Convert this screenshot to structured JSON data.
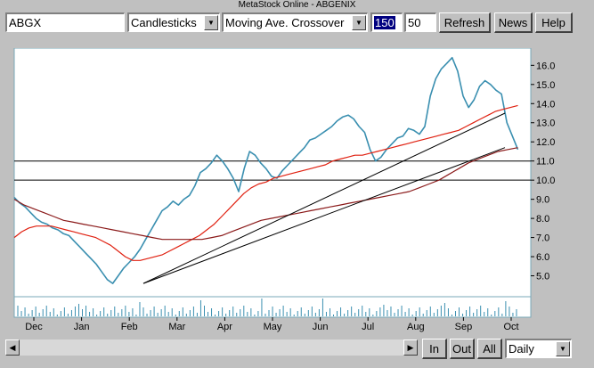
{
  "window": {
    "title": "MetaStock Online - ABGENIX"
  },
  "toolbar": {
    "symbol": "ABGX",
    "chart_style": "Candlesticks",
    "study": "Moving Ave. Crossover",
    "period1": "150",
    "period2": "50",
    "refresh_label": "Refresh",
    "news_label": "News",
    "help_label": "Help"
  },
  "bottom": {
    "in_label": "In",
    "out_label": "Out",
    "all_label": "All",
    "interval": "Daily"
  },
  "colors": {
    "price": "#3a8fb0",
    "ma_short": "#e02010",
    "ma_long": "#8b1a1a",
    "trendline": "#000000",
    "grid_border": "#7aa9b8"
  },
  "chart_data": {
    "type": "line",
    "y_ticks": [
      5.0,
      6.0,
      7.0,
      8.0,
      9.0,
      10.0,
      11.0,
      12.0,
      13.0,
      14.0,
      15.0,
      16.0
    ],
    "ylim": [
      4.0,
      16.9
    ],
    "x_ticks": [
      "Dec",
      "Jan",
      "Feb",
      "Mar",
      "Apr",
      "May",
      "Jun",
      "Jul",
      "Aug",
      "Sep",
      "Oct"
    ],
    "horizontal_lines": [
      11.0,
      10.0
    ],
    "series": [
      {
        "values": [
          9.1,
          8.8,
          8.6,
          8.3,
          8.0,
          7.8,
          7.7,
          7.5,
          7.4,
          7.2,
          7.1,
          6.8,
          6.5,
          6.2,
          5.9,
          5.6,
          5.2,
          4.8,
          4.6,
          5.0,
          5.4,
          5.7,
          6.0,
          6.4,
          6.9,
          7.4,
          7.9,
          8.4,
          8.6,
          8.9,
          8.7,
          9.0,
          9.2,
          9.7,
          10.4,
          10.6,
          10.9,
          11.3,
          11.0,
          10.6,
          10.1,
          9.4,
          10.6,
          11.5,
          11.3,
          10.9,
          10.6,
          10.2,
          10.1,
          10.5,
          10.8,
          11.1,
          11.4,
          11.7,
          12.1,
          12.2,
          12.4,
          12.6,
          12.8,
          13.1,
          13.3,
          13.4,
          13.2,
          12.8,
          12.5,
          11.6,
          11.0,
          11.2,
          11.6,
          11.9,
          12.2,
          12.3,
          12.7,
          12.6,
          12.4,
          12.8,
          14.4,
          15.3,
          15.8,
          16.1,
          16.4,
          15.7,
          14.4,
          13.8,
          14.2,
          14.9,
          15.2,
          15.0,
          14.7,
          14.5,
          13.0,
          12.3,
          11.6
        ]
      },
      {
        "values": [
          7.0,
          7.3,
          7.5,
          7.6,
          7.6,
          7.6,
          7.5,
          7.4,
          7.3,
          7.2,
          7.1,
          7.0,
          6.8,
          6.6,
          6.3,
          6.0,
          5.8,
          5.8,
          5.9,
          6.0,
          6.1,
          6.3,
          6.5,
          6.7,
          6.9,
          7.1,
          7.4,
          7.7,
          8.1,
          8.5,
          8.9,
          9.3,
          9.6,
          9.8,
          9.9,
          10.1,
          10.2,
          10.3,
          10.4,
          10.5,
          10.6,
          10.7,
          10.8,
          11.0,
          11.1,
          11.2,
          11.3,
          11.3,
          11.4,
          11.5,
          11.6,
          11.7,
          11.8,
          11.9,
          12.0,
          12.1,
          12.2,
          12.3,
          12.4,
          12.5,
          12.6,
          12.8,
          13.0,
          13.2,
          13.4,
          13.6,
          13.7,
          13.8,
          13.9
        ]
      },
      {
        "values": [
          9.0,
          8.7,
          8.5,
          8.3,
          8.1,
          7.9,
          7.8,
          7.7,
          7.6,
          7.5,
          7.4,
          7.3,
          7.2,
          7.1,
          7.0,
          6.9,
          6.9,
          6.9,
          6.9,
          6.9,
          7.0,
          7.1,
          7.3,
          7.5,
          7.7,
          7.9,
          8.0,
          8.1,
          8.2,
          8.3,
          8.4,
          8.5,
          8.6,
          8.7,
          8.8,
          8.9,
          9.0,
          9.1,
          9.2,
          9.3,
          9.4,
          9.6,
          9.8,
          10.0,
          10.3,
          10.6,
          10.9,
          11.1,
          11.3,
          11.5,
          11.6,
          11.7
        ]
      }
    ],
    "trendlines": [
      {
        "from": [
          0.25,
          4.6
        ],
        "to": [
          0.95,
          11.7
        ]
      },
      {
        "from": [
          0.25,
          4.6
        ],
        "to": [
          0.95,
          13.5
        ]
      }
    ]
  }
}
